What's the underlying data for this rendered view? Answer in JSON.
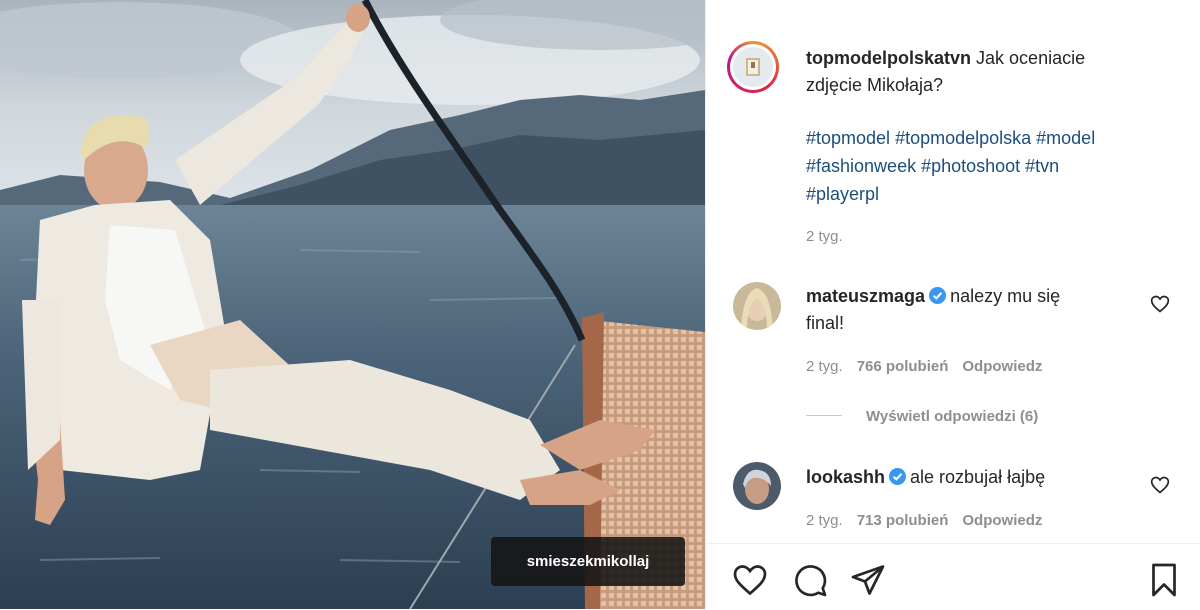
{
  "post": {
    "username": "topmodelpolskatvn",
    "caption": "Jak oceniacie zdjęcie Mikołaja?",
    "caption_line1": "Jak oceniacie",
    "caption_line2": "zdjęcie Mikołaja?",
    "hashtags": [
      "#topmodel",
      "#topmodelpolska",
      "#model",
      "#fashionweek",
      "#photoshoot",
      "#tvn",
      "#playerpl"
    ],
    "time": "2 tyg."
  },
  "photo": {
    "tagged_user": "smieszekmikollaj"
  },
  "comments": [
    {
      "username": "mateuszmaga",
      "verified": true,
      "text_line1": "nalezy mu się",
      "text_line2": "final!",
      "time": "2 tyg.",
      "likes": "766 polubień",
      "reply": "Odpowiedz",
      "view_replies": "Wyświetl odpowiedzi (6)"
    },
    {
      "username": "lookashh",
      "verified": true,
      "text_line1": "ale rozbujał łajbę",
      "time": "2 tyg.",
      "likes": "713 polubień",
      "reply": "Odpowiedz"
    }
  ],
  "icons": {
    "like": "heart-icon",
    "comment": "comment-icon",
    "share": "paper-plane-icon",
    "save": "bookmark-icon",
    "verified": "verified-badge-icon"
  },
  "colors": {
    "hashtag": "#1c4e7d",
    "verified": "#3897f0",
    "muted": "#8e8e8e"
  }
}
